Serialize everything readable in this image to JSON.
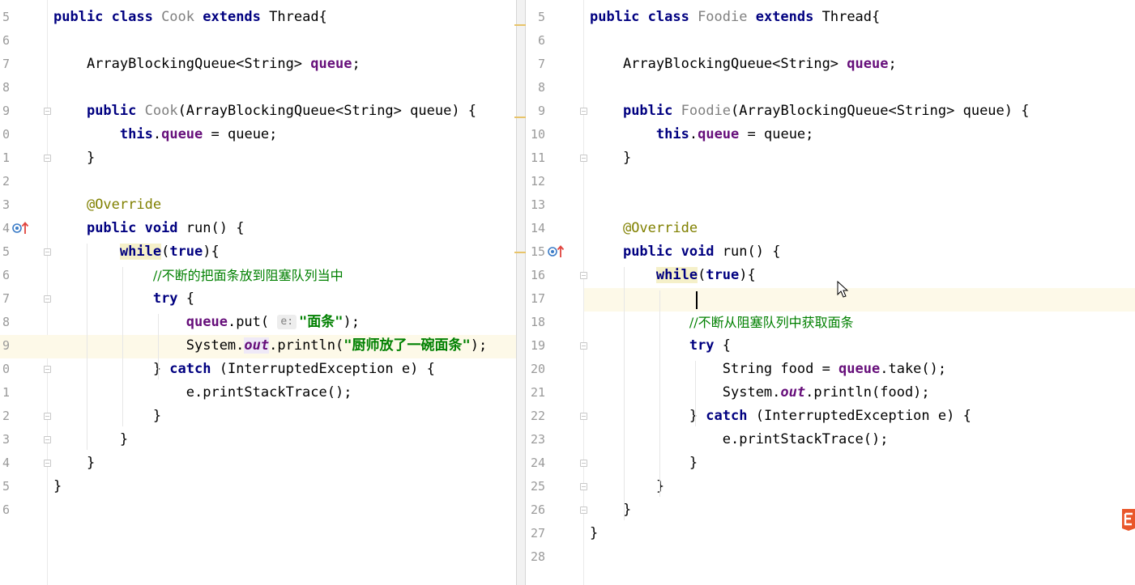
{
  "left": {
    "lines": [
      {
        "n": "5",
        "parts": [
          {
            "t": "public class ",
            "c": "kw"
          },
          {
            "t": "Cook ",
            "c": "cls"
          },
          {
            "t": "extends ",
            "c": "kw"
          },
          {
            "t": "Thread{",
            "c": ""
          }
        ]
      },
      {
        "n": "6",
        "parts": []
      },
      {
        "n": "7",
        "parts": [
          {
            "t": "    ArrayBlockingQueue<String> ",
            "c": ""
          },
          {
            "t": "queue",
            "c": "fld"
          },
          {
            "t": ";",
            "c": ""
          }
        ]
      },
      {
        "n": "8",
        "parts": []
      },
      {
        "n": "9",
        "parts": [
          {
            "t": "    ",
            "c": ""
          },
          {
            "t": "public ",
            "c": "kw"
          },
          {
            "t": "Cook",
            "c": "cls"
          },
          {
            "t": "(ArrayBlockingQueue<String> queue) {",
            "c": ""
          }
        ]
      },
      {
        "n": "0",
        "parts": [
          {
            "t": "        ",
            "c": ""
          },
          {
            "t": "this",
            "c": "kw"
          },
          {
            "t": ".",
            "c": ""
          },
          {
            "t": "queue",
            "c": "fld"
          },
          {
            "t": " = queue;",
            "c": ""
          }
        ]
      },
      {
        "n": "1",
        "parts": [
          {
            "t": "    }",
            "c": ""
          }
        ]
      },
      {
        "n": "2",
        "parts": []
      },
      {
        "n": "3",
        "parts": [
          {
            "t": "    ",
            "c": ""
          },
          {
            "t": "@Override",
            "c": "ann"
          }
        ]
      },
      {
        "n": "4",
        "parts": [
          {
            "t": "    ",
            "c": ""
          },
          {
            "t": "public void ",
            "c": "kw"
          },
          {
            "t": "run() {",
            "c": ""
          }
        ]
      },
      {
        "n": "5",
        "parts": [
          {
            "t": "        ",
            "c": ""
          },
          {
            "t": "while",
            "c": "kw match"
          },
          {
            "t": "(",
            "c": ""
          },
          {
            "t": "true",
            "c": "kw"
          },
          {
            "t": "){",
            "c": ""
          }
        ]
      },
      {
        "n": "6",
        "parts": [
          {
            "t": "            ",
            "c": ""
          },
          {
            "t": "//不断的把面条放到阻塞队列当中",
            "c": "cmt"
          }
        ]
      },
      {
        "n": "7",
        "parts": [
          {
            "t": "            ",
            "c": ""
          },
          {
            "t": "try ",
            "c": "kw"
          },
          {
            "t": "{",
            "c": ""
          }
        ]
      },
      {
        "n": "8",
        "parts": [
          {
            "t": "                ",
            "c": ""
          },
          {
            "t": "queue",
            "c": "fld"
          },
          {
            "t": ".put( ",
            "c": ""
          },
          {
            "t": "e:",
            "c": "hint"
          },
          {
            "t": "\"面条\"",
            "c": "str"
          },
          {
            "t": ");",
            "c": ""
          }
        ]
      },
      {
        "n": "9",
        "parts": [
          {
            "t": "                System.",
            "c": ""
          },
          {
            "t": "out",
            "c": "stat match2"
          },
          {
            "t": ".println(",
            "c": ""
          },
          {
            "t": "\"厨师放了一碗面条\"",
            "c": "str"
          },
          {
            "t": ");",
            "c": ""
          }
        ]
      },
      {
        "n": "0",
        "parts": [
          {
            "t": "            } ",
            "c": ""
          },
          {
            "t": "catch ",
            "c": "kw"
          },
          {
            "t": "(InterruptedException e) {",
            "c": ""
          }
        ]
      },
      {
        "n": "1",
        "parts": [
          {
            "t": "                e.printStackTrace();",
            "c": ""
          }
        ]
      },
      {
        "n": "2",
        "parts": [
          {
            "t": "            }",
            "c": ""
          }
        ]
      },
      {
        "n": "3",
        "parts": [
          {
            "t": "        }",
            "c": ""
          }
        ]
      },
      {
        "n": "4",
        "parts": [
          {
            "t": "    }",
            "c": ""
          }
        ]
      },
      {
        "n": "5",
        "parts": [
          {
            "t": "}",
            "c": ""
          }
        ]
      },
      {
        "n": "6",
        "parts": []
      }
    ]
  },
  "right": {
    "lines": [
      {
        "n": "5",
        "parts": [
          {
            "t": "public class ",
            "c": "kw"
          },
          {
            "t": "Foodie ",
            "c": "cls"
          },
          {
            "t": "extends ",
            "c": "kw"
          },
          {
            "t": "Thread{",
            "c": ""
          }
        ]
      },
      {
        "n": "6",
        "parts": []
      },
      {
        "n": "7",
        "parts": [
          {
            "t": "    ArrayBlockingQueue<String> ",
            "c": ""
          },
          {
            "t": "queue",
            "c": "fld"
          },
          {
            "t": ";",
            "c": ""
          }
        ]
      },
      {
        "n": "8",
        "parts": []
      },
      {
        "n": "9",
        "parts": [
          {
            "t": "    ",
            "c": ""
          },
          {
            "t": "public ",
            "c": "kw"
          },
          {
            "t": "Foodie",
            "c": "cls"
          },
          {
            "t": "(ArrayBlockingQueue<String> queue) {",
            "c": ""
          }
        ]
      },
      {
        "n": "10",
        "parts": [
          {
            "t": "        ",
            "c": ""
          },
          {
            "t": "this",
            "c": "kw"
          },
          {
            "t": ".",
            "c": ""
          },
          {
            "t": "queue",
            "c": "fld"
          },
          {
            "t": " = queue;",
            "c": ""
          }
        ]
      },
      {
        "n": "11",
        "parts": [
          {
            "t": "    }",
            "c": ""
          }
        ]
      },
      {
        "n": "12",
        "parts": []
      },
      {
        "n": "13",
        "parts": []
      },
      {
        "n": "14",
        "parts": [
          {
            "t": "    ",
            "c": ""
          },
          {
            "t": "@Override",
            "c": "ann"
          }
        ]
      },
      {
        "n": "15",
        "parts": [
          {
            "t": "    ",
            "c": ""
          },
          {
            "t": "public void ",
            "c": "kw"
          },
          {
            "t": "run() {",
            "c": ""
          }
        ]
      },
      {
        "n": "16",
        "parts": [
          {
            "t": "        ",
            "c": ""
          },
          {
            "t": "while",
            "c": "kw match"
          },
          {
            "t": "(",
            "c": ""
          },
          {
            "t": "true",
            "c": "kw"
          },
          {
            "t": "){",
            "c": ""
          }
        ]
      },
      {
        "n": "17",
        "parts": []
      },
      {
        "n": "18",
        "parts": [
          {
            "t": "            ",
            "c": ""
          },
          {
            "t": "//不断从阻塞队列中获取面条",
            "c": "cmt"
          }
        ]
      },
      {
        "n": "19",
        "parts": [
          {
            "t": "            ",
            "c": ""
          },
          {
            "t": "try ",
            "c": "kw"
          },
          {
            "t": "{",
            "c": ""
          }
        ]
      },
      {
        "n": "20",
        "parts": [
          {
            "t": "                String food = ",
            "c": ""
          },
          {
            "t": "queue",
            "c": "fld"
          },
          {
            "t": ".take();",
            "c": ""
          }
        ]
      },
      {
        "n": "21",
        "parts": [
          {
            "t": "                System.",
            "c": ""
          },
          {
            "t": "out",
            "c": "stat"
          },
          {
            "t": ".println(food);",
            "c": ""
          }
        ]
      },
      {
        "n": "22",
        "parts": [
          {
            "t": "            } ",
            "c": ""
          },
          {
            "t": "catch ",
            "c": "kw"
          },
          {
            "t": "(InterruptedException e) {",
            "c": ""
          }
        ]
      },
      {
        "n": "23",
        "parts": [
          {
            "t": "                e.printStackTrace();",
            "c": ""
          }
        ]
      },
      {
        "n": "24",
        "parts": [
          {
            "t": "            }",
            "c": ""
          }
        ]
      },
      {
        "n": "25",
        "parts": [
          {
            "t": "        }",
            "c": ""
          }
        ]
      },
      {
        "n": "26",
        "parts": [
          {
            "t": "    }",
            "c": ""
          }
        ]
      },
      {
        "n": "27",
        "parts": [
          {
            "t": "}",
            "c": ""
          }
        ]
      },
      {
        "n": "28",
        "parts": []
      }
    ]
  },
  "icons": {
    "left_override_gutter": "override-method-icon",
    "right_override_gutter": "override-method-icon",
    "mouse": "mouse-pointer-icon",
    "corner_logo": "logo-icon"
  },
  "colors": {
    "keyword": "#000080",
    "field": "#660e7a",
    "annotation": "#808000",
    "comment": "#008000",
    "string": "#008000",
    "current_line": "#fdf9e8"
  }
}
